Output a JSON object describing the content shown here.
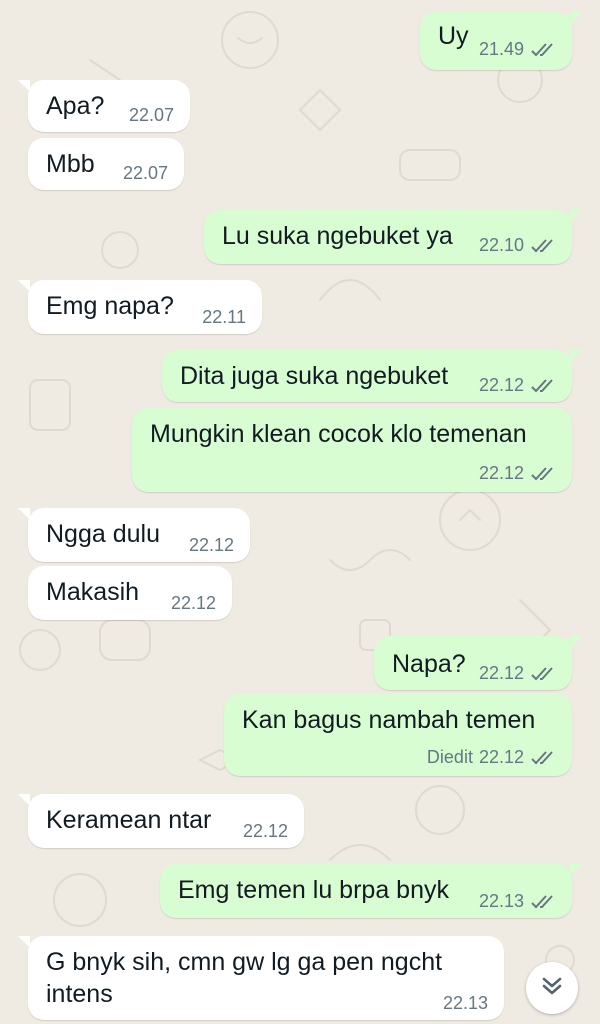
{
  "chat": {
    "messages": [
      {
        "direction": "out",
        "text": "Uy",
        "time": "21.49"
      },
      {
        "direction": "in",
        "text": "Apa?",
        "time": "22.07"
      },
      {
        "direction": "in",
        "text": "Mbb",
        "time": "22.07"
      },
      {
        "direction": "out",
        "text": "Lu suka ngebuket ya",
        "time": "22.10"
      },
      {
        "direction": "in",
        "text": "Emg napa?",
        "time": "22.11"
      },
      {
        "direction": "out",
        "text": "Dita juga suka ngebuket",
        "time": "22.12"
      },
      {
        "direction": "out",
        "text": "Mungkin klean cocok klo temenan",
        "time": "22.12"
      },
      {
        "direction": "in",
        "text": "Ngga dulu",
        "time": "22.12"
      },
      {
        "direction": "in",
        "text": "Makasih",
        "time": "22.12"
      },
      {
        "direction": "out",
        "text": "Napa?",
        "time": "22.12"
      },
      {
        "direction": "out",
        "text": "Kan bagus nambah temen",
        "time": "22.12",
        "edited_label": "Diedit"
      },
      {
        "direction": "in",
        "text": "Keramean ntar",
        "time": "22.12"
      },
      {
        "direction": "out",
        "text": "Emg temen lu brpa bnyk",
        "time": "22.13"
      },
      {
        "direction": "in",
        "text": "G bnyk sih, cmn gw lg ga pen ngcht intens",
        "time": "22.13"
      }
    ]
  },
  "colors": {
    "background": "#efeae2",
    "incoming_bubble": "#ffffff",
    "outgoing_bubble": "#d9fdd3",
    "text": "#111b21",
    "meta": "#667781"
  },
  "icons": {
    "read_receipt": "double-check-icon",
    "scroll_down": "double-chevron-down-icon"
  }
}
